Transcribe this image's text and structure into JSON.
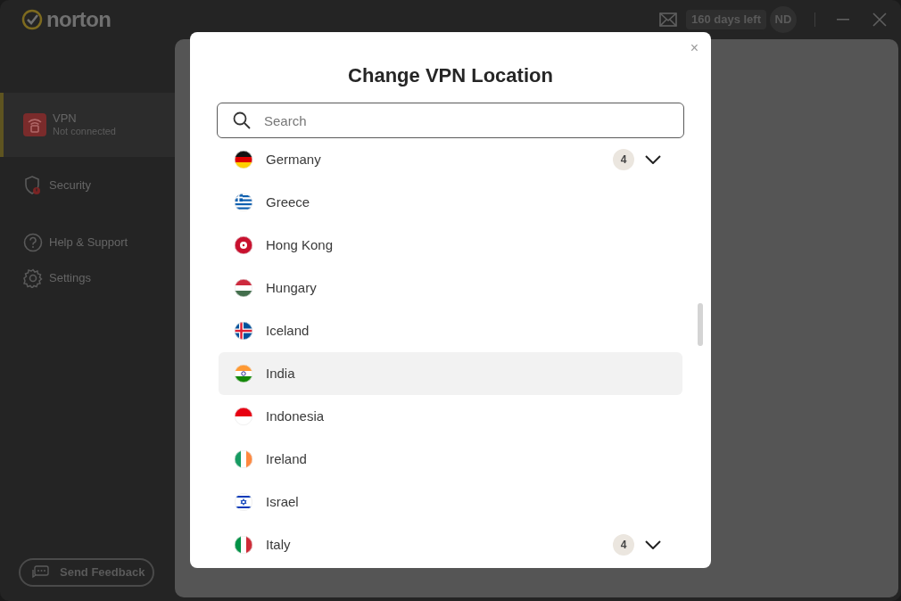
{
  "app": {
    "logo": "norton",
    "trial": "160 days left",
    "avatar": "ND"
  },
  "sidebar": {
    "items": [
      {
        "kind": "vpn",
        "label": "VPN",
        "sublabel": "Not connected",
        "selected": true
      },
      {
        "kind": "security",
        "label": "Security",
        "selected": false
      },
      {
        "kind": "help",
        "label": "Help & Support",
        "selected": false
      },
      {
        "kind": "settings",
        "label": "Settings",
        "selected": false
      }
    ],
    "feedback_button": "Send Feedback"
  },
  "dialog": {
    "title": "Change VPN Location",
    "close": "×",
    "search": {
      "placeholder": "Search"
    },
    "locations": [
      {
        "kind": "de",
        "name": "Germany",
        "count": "4",
        "expanded": false,
        "hovered": false
      },
      {
        "kind": "gr",
        "name": "Greece",
        "hovered": false
      },
      {
        "kind": "hk",
        "name": "Hong Kong",
        "hovered": false
      },
      {
        "kind": "hu",
        "name": "Hungary",
        "hovered": false
      },
      {
        "kind": "is",
        "name": "Iceland",
        "hovered": false
      },
      {
        "kind": "in",
        "name": "India",
        "hovered": true
      },
      {
        "kind": "id",
        "name": "Indonesia",
        "hovered": false
      },
      {
        "kind": "ie",
        "name": "Ireland",
        "hovered": false
      },
      {
        "kind": "il",
        "name": "Israel",
        "hovered": false
      },
      {
        "kind": "it",
        "name": "Italy",
        "count": "4",
        "expanded": false,
        "hovered": false
      }
    ]
  }
}
